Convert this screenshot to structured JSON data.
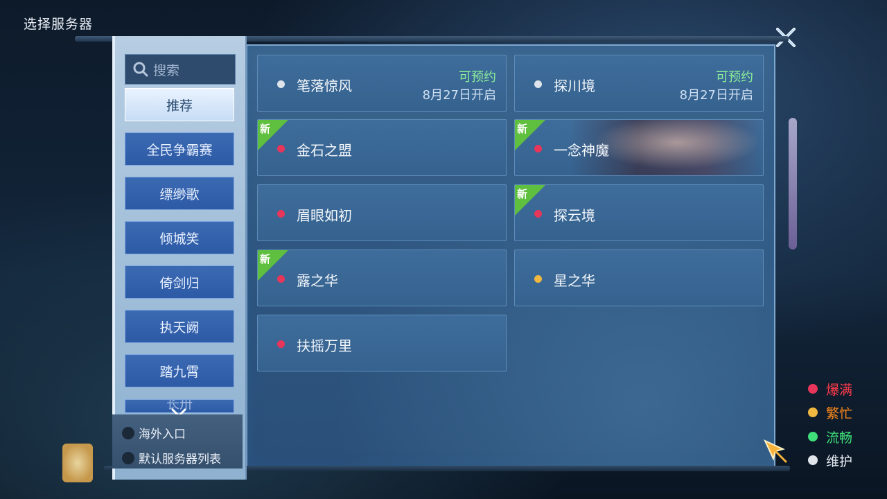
{
  "page_title": "选择服务器",
  "search": {
    "placeholder": "搜索"
  },
  "categories": [
    {
      "label": "推荐"
    },
    {
      "label": "全民争霸赛"
    },
    {
      "label": "缥缈歌"
    },
    {
      "label": "倾城笑"
    },
    {
      "label": "倚剑归"
    },
    {
      "label": "执天阙"
    },
    {
      "label": "踏九霄"
    },
    {
      "label": "长卅"
    }
  ],
  "options": {
    "overseas": "海外入口",
    "default_list": "默认服务器列表"
  },
  "servers": [
    {
      "name": "笔落惊风",
      "status_color": "#dfe4ea",
      "tag": "可预约",
      "date": "8月27日开启",
      "new": false
    },
    {
      "name": "探川境",
      "status_color": "#dfe4ea",
      "tag": "可预约",
      "date": "8月27日开启",
      "new": false
    },
    {
      "name": "金石之盟",
      "status_color": "#e8355a",
      "new": true,
      "new_label": "新"
    },
    {
      "name": "一念神魔",
      "status_color": "#e8355a",
      "new": true,
      "new_label": "新"
    },
    {
      "name": "眉眼如初",
      "status_color": "#e8355a",
      "new": false
    },
    {
      "name": "探云境",
      "status_color": "#e8355a",
      "new": true,
      "new_label": "新"
    },
    {
      "name": "露之华",
      "status_color": "#e8355a",
      "new": true,
      "new_label": "新"
    },
    {
      "name": "星之华",
      "status_color": "#f0b840",
      "new": false
    },
    {
      "name": "扶摇万里",
      "status_color": "#e8355a",
      "new": false
    }
  ],
  "legend": [
    {
      "label": "爆满",
      "color": "#e8355a",
      "text_color": "#ff3a4a"
    },
    {
      "label": "繁忙",
      "color": "#f0b840",
      "text_color": "#ff8a1a"
    },
    {
      "label": "流畅",
      "color": "#3fe07a",
      "text_color": "#3fe07a"
    },
    {
      "label": "维护",
      "color": "#dfe4ea",
      "text_color": "#e6ebf2"
    }
  ]
}
